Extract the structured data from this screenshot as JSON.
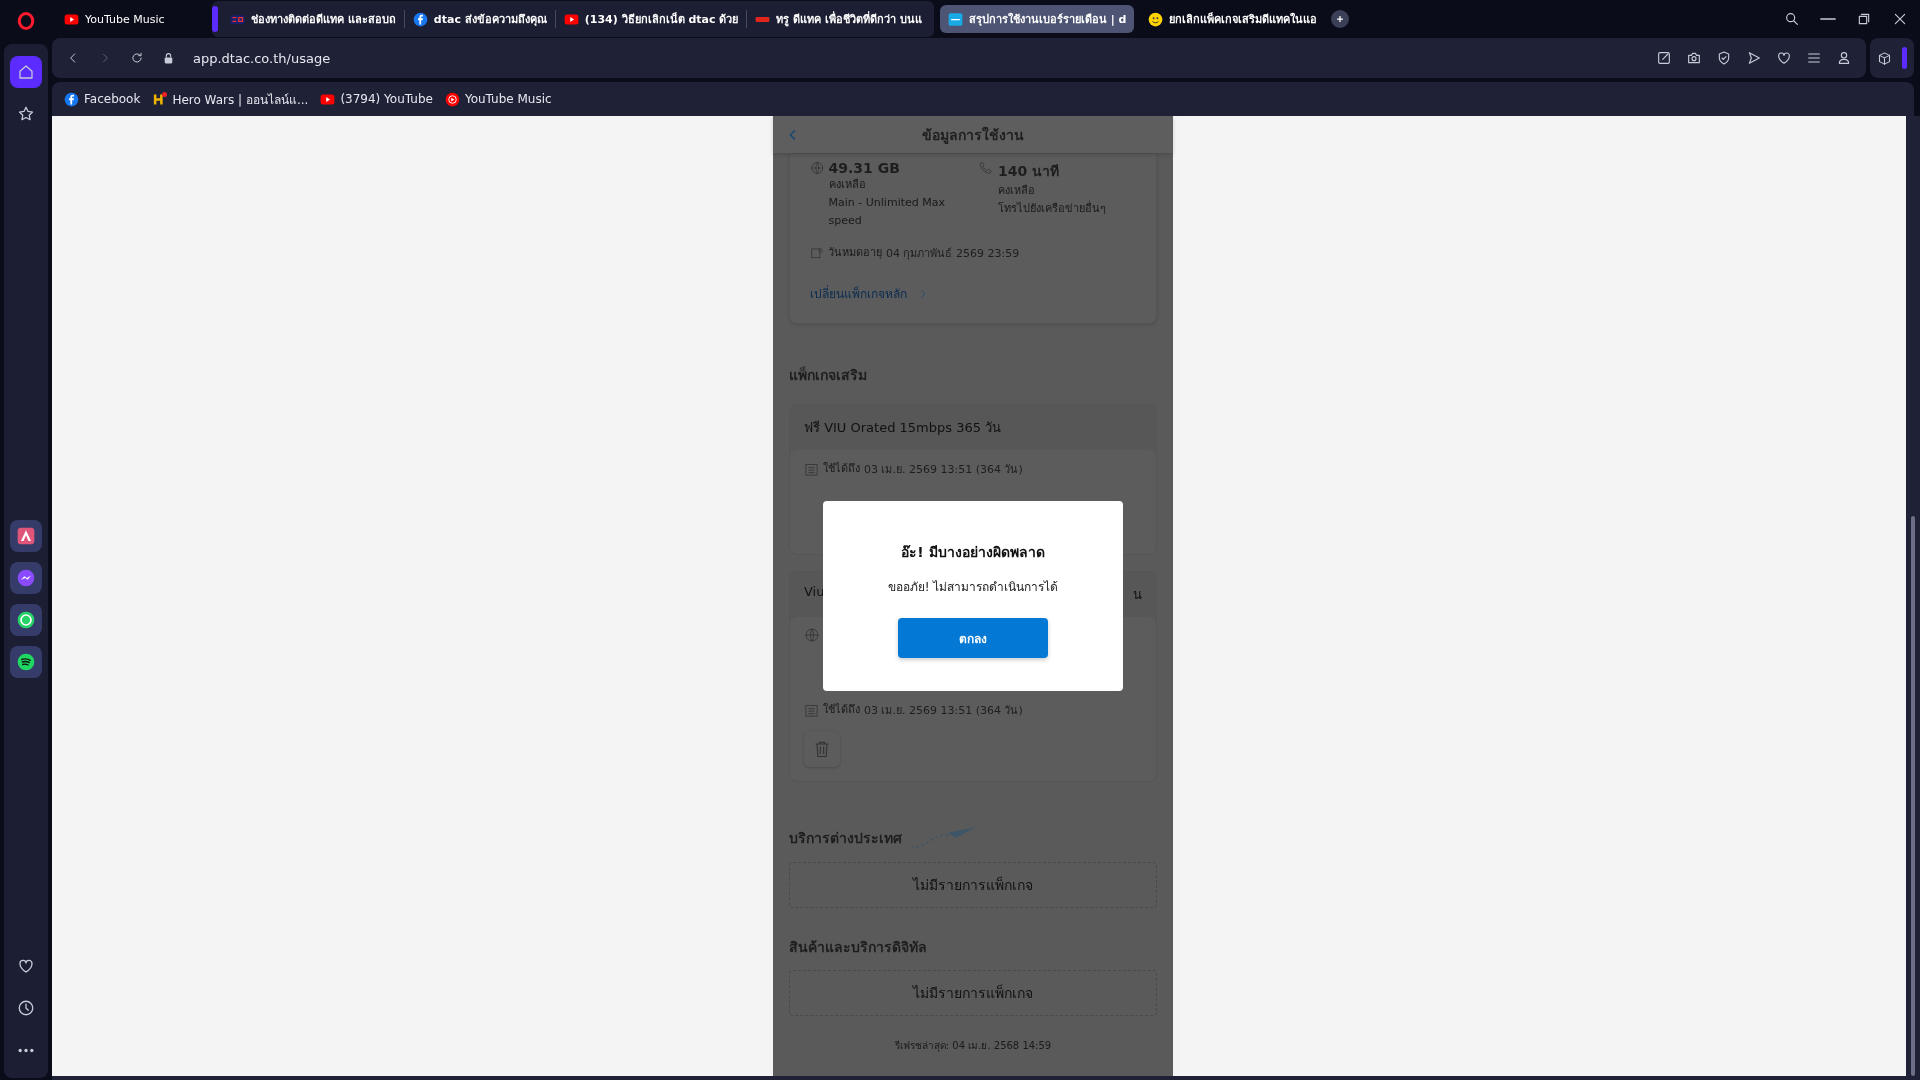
{
  "pinned_tab": {
    "title": "YouTube Music",
    "kind": "youtube"
  },
  "tabs": [
    {
      "title": "ช่องทางติดต่อดีแทค และสอบถ",
      "kind": "fiveg",
      "selected": false
    },
    {
      "title": "dtac ส่งข้อความถึงคุณ",
      "kind": "facebook",
      "selected": false
    },
    {
      "title": "(134) วิธียกเลิกเน็ต dtac ด้วย",
      "kind": "youtube",
      "selected": false
    },
    {
      "title": "ทรู ดีแทค เพื่อชีวิตที่ดีกว่า บนแ",
      "kind": "true",
      "selected": false
    },
    {
      "title": "สรุปการใช้งานเบอร์รายเดือน | d",
      "kind": "dtac",
      "selected": true
    },
    {
      "title": "ยกเลิกแพ็คเกจเสริมดีแทคในแอ",
      "kind": "emoji",
      "selected": false
    }
  ],
  "address": "app.dtac.co.th/usage",
  "bookmarks": [
    {
      "label": "Facebook",
      "kind": "facebook"
    },
    {
      "label": "Hero Wars | ออนไลน์แ...",
      "kind": "game"
    },
    {
      "label": "(3794) YouTube",
      "kind": "youtube"
    },
    {
      "label": "YouTube Music",
      "kind": "ytmusic"
    }
  ],
  "page": {
    "header_title": "ข้อมูลการใช้งาน",
    "usage": [
      {
        "kind": "data",
        "amount": "49.31 GB",
        "label": "คงเหลือ",
        "detail": "Main - Unlimited Max speed"
      },
      {
        "kind": "voice",
        "amount": "140 นาที",
        "label": "คงเหลือ",
        "detail": "โทรไปยังเครือข่ายอื่นๆ"
      }
    ],
    "expiry_label": "วันหมดอายุ",
    "expiry_value": "04 กุมภาพันธ์ 2569 23:59",
    "change_link": "เปลี่ยนแพ็กเกจหลัก",
    "addons_title": "แพ็กเกจเสริม",
    "addons": [
      {
        "kind": "plain",
        "title": "ฟรี VIU Orated 15mbps 365 วัน",
        "valid_label": "ใช้ได้ถึง",
        "valid_value": "03 เม.ย. 2569 13:51 (364 วัน)"
      },
      {
        "kind": "data",
        "title": "Viu",
        "title_end": "น",
        "valid_label": "ใช้ได้ถึง",
        "valid_value": "03 เม.ย. 2569 13:51 (364 วัน)"
      }
    ],
    "sections": [
      {
        "kind": "travel",
        "title": "บริการต่างประเทศ",
        "empty": "ไม่มีรายการแพ็กเกจ"
      },
      {
        "kind": "plain",
        "title": "สินค้าและบริการดิจิทัล",
        "empty": "ไม่มีรายการแพ็กเกจ"
      }
    ],
    "refresh": "รีเฟรชล่าสุด: 04 เม.ย. 2568 14:59"
  },
  "dialog": {
    "title": "อ๊ะ! มีบางอย่างผิดพลาด",
    "message": "ขออภัย! ไม่สามารถดำเนินการได้",
    "button": "ตกลง"
  }
}
